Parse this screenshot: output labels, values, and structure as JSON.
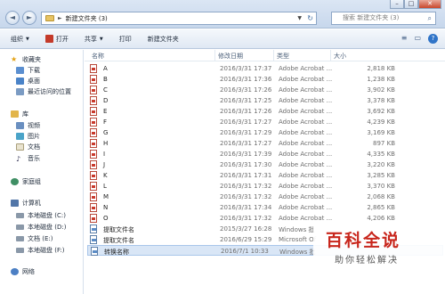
{
  "window": {
    "minimize": "–",
    "maximize": "□",
    "close": "✕"
  },
  "nav": {
    "back": "◄",
    "forward": "►"
  },
  "address": {
    "separator": "►",
    "path": "新建文件夹 (3)",
    "dropdown": "▼",
    "refresh": "↻"
  },
  "search": {
    "placeholder": "搜索 新建文件夹 (3)",
    "icon": "search-icon"
  },
  "toolbar": {
    "organize": "组织",
    "open": "打开",
    "share": "共享",
    "print": "打印",
    "new_folder": "新建文件夹",
    "caret": "▼",
    "view": "≡",
    "preview": "▭",
    "help": "?"
  },
  "sidebar": {
    "favorites": "收藏夹",
    "downloads": "下载",
    "desktop": "桌面",
    "recent": "最近访问的位置",
    "libraries": "库",
    "videos": "视频",
    "pictures": "图片",
    "documents": "文档",
    "music": "音乐",
    "homegroup": "家庭组",
    "computer": "计算机",
    "drive_c": "本地磁盘 (C:)",
    "drive_d": "本地磁盘 (D:)",
    "drive_e": "文档 (E:)",
    "drive_f": "本地磁盘 (F:)",
    "network": "网络"
  },
  "columns": {
    "name": "名称",
    "date": "修改日期",
    "type": "类型",
    "size": "大小"
  },
  "files": [
    {
      "name": "A",
      "date": "2016/3/31 17:37",
      "type": "Adobe Acrobat ...",
      "size": "2,818 KB"
    },
    {
      "name": "B",
      "date": "2016/3/31 17:36",
      "type": "Adobe Acrobat ...",
      "size": "1,238 KB"
    },
    {
      "name": "C",
      "date": "2016/3/31 17:26",
      "type": "Adobe Acrobat ...",
      "size": "3,902 KB"
    },
    {
      "name": "D",
      "date": "2016/3/31 17:25",
      "type": "Adobe Acrobat ...",
      "size": "3,378 KB"
    },
    {
      "name": "E",
      "date": "2016/3/31 17:26",
      "type": "Adobe Acrobat ...",
      "size": "3,692 KB"
    },
    {
      "name": "F",
      "date": "2016/3/31 17:27",
      "type": "Adobe Acrobat ...",
      "size": "4,239 KB"
    },
    {
      "name": "G",
      "date": "2016/3/31 17:29",
      "type": "Adobe Acrobat ...",
      "size": "3,169 KB"
    },
    {
      "name": "H",
      "date": "2016/3/31 17:27",
      "type": "Adobe Acrobat ...",
      "size": "897 KB"
    },
    {
      "name": "I",
      "date": "2016/3/31 17:39",
      "type": "Adobe Acrobat ...",
      "size": "4,335 KB"
    },
    {
      "name": "J",
      "date": "2016/3/31 17:30",
      "type": "Adobe Acrobat ...",
      "size": "3,220 KB"
    },
    {
      "name": "K",
      "date": "2016/3/31 17:31",
      "type": "Adobe Acrobat ...",
      "size": "3,285 KB"
    },
    {
      "name": "L",
      "date": "2016/3/31 17:32",
      "type": "Adobe Acrobat ...",
      "size": "3,370 KB"
    },
    {
      "name": "M",
      "date": "2016/3/31 17:32",
      "type": "Adobe Acrobat ...",
      "size": "2,068 KB"
    },
    {
      "name": "N",
      "date": "2016/3/31 17:34",
      "type": "Adobe Acrobat ...",
      "size": "2,865 KB"
    },
    {
      "name": "O",
      "date": "2016/3/31 17:32",
      "type": "Adobe Acrobat ...",
      "size": "4,206 KB"
    },
    {
      "name": "提取文件名",
      "date": "2015/3/27 16:28",
      "type": "Windows 批",
      "size": ""
    },
    {
      "name": "提取文件名",
      "date": "2016/6/29 15:29",
      "type": "Microsoft Of",
      "size": ""
    },
    {
      "name": "转换名称",
      "date": "2016/7/1 10:33",
      "type": "Windows 批",
      "size": ""
    }
  ],
  "watermark": {
    "title": "百科全说",
    "subtitle": "助你轻松解决"
  }
}
